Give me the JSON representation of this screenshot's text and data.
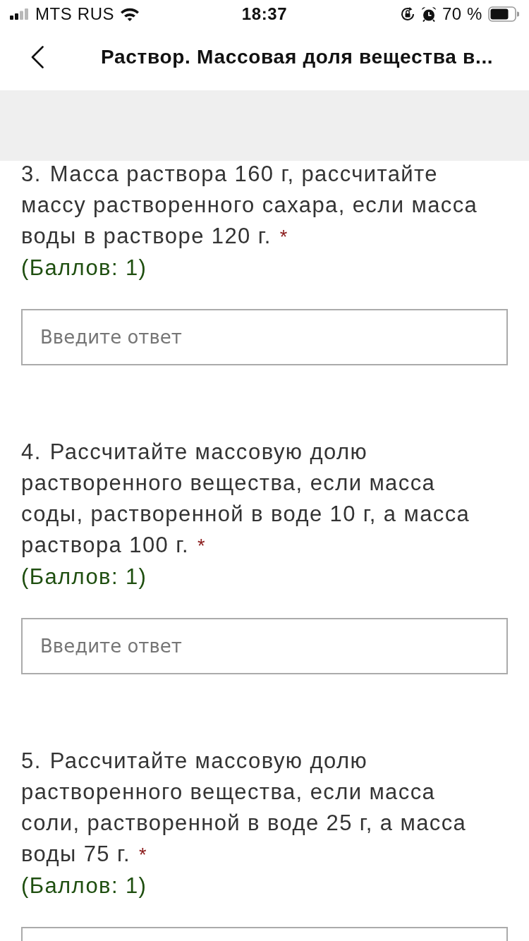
{
  "status_bar": {
    "carrier": "MTS RUS",
    "time": "18:37",
    "battery": "70 %"
  },
  "nav_bar": {
    "title": "Раствор. Массовая доля вещества в..."
  },
  "questions": [
    {
      "number": "3.",
      "text": "Масса раствора 160 г, рассчитайте массу растворенного сахара, если масса воды в растворе 120 г.",
      "required_mark": "*",
      "points": "(Баллов: 1)",
      "answer": {
        "placeholder": "Введите ответ"
      }
    },
    {
      "number": "4.",
      "text": "Рассчитайте массовую долю растворенного вещества, если масса соды, растворенной в воде 10 г, а масса раствора 100 г.",
      "required_mark": "*",
      "points": "(Баллов: 1)",
      "answer": {
        "placeholder": "Введите ответ"
      }
    },
    {
      "number": "5.",
      "text": "Рассчитайте массовую долю растворенного вещества, если масса соли, растворенной в воде 25 г, а масса воды 75 г.",
      "required_mark": "*",
      "points": "(Баллов: 1)"
    }
  ]
}
